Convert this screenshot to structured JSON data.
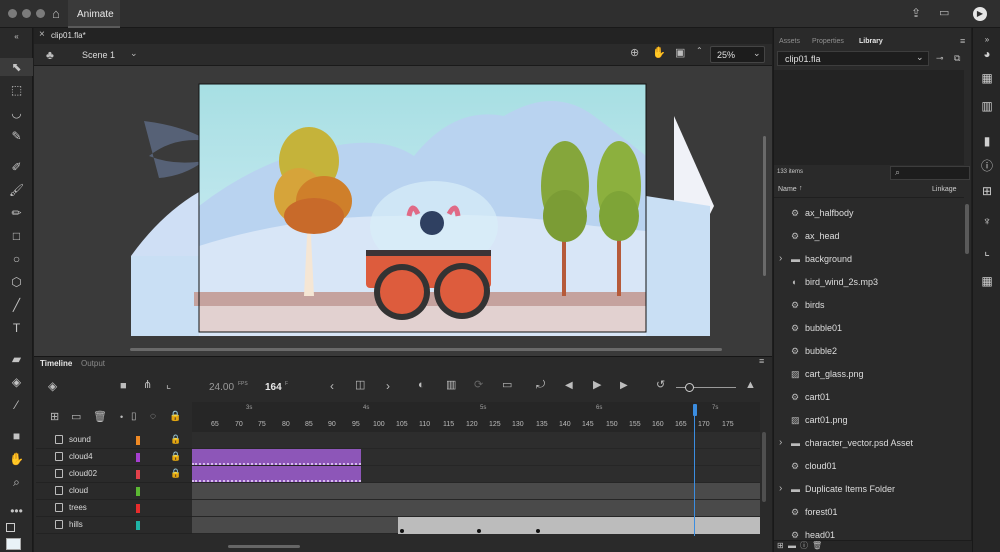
{
  "app": {
    "title": "Animate"
  },
  "document": {
    "tab": "clip01.fla*",
    "scene": "Scene 1",
    "zoom": "25%"
  },
  "timeline": {
    "tabs": [
      "Timeline",
      "Output"
    ],
    "fps_value": "24.00",
    "fps_unit": "FPS",
    "current_frame": "164",
    "frame_unit": "F",
    "seconds": [
      "3s",
      "4s",
      "5s",
      "6s",
      "7s"
    ],
    "frame_numbers": [
      "65",
      "70",
      "75",
      "80",
      "85",
      "90",
      "95",
      "100",
      "105",
      "110",
      "115",
      "120",
      "125",
      "130",
      "135",
      "140",
      "145",
      "150",
      "155",
      "160",
      "165",
      "170",
      "175"
    ],
    "layers": [
      {
        "name": "sound",
        "color": "#f08a24"
      },
      {
        "name": "cloud4",
        "color": "#a63fd0"
      },
      {
        "name": "cloud02",
        "color": "#e2414b"
      },
      {
        "name": "cloud",
        "color": "#5cb833"
      },
      {
        "name": "trees",
        "color": "#e82c2c"
      },
      {
        "name": "hills",
        "color": "#1fb3a6"
      }
    ]
  },
  "library": {
    "tabs": [
      "Assets",
      "Properties",
      "Library"
    ],
    "file": "clip01.fla",
    "count": "133 items",
    "col_name": "Name",
    "col_linkage": "Linkage",
    "items": [
      {
        "label": "ax_halfbody",
        "icon": "symbol-icon",
        "folder": false
      },
      {
        "label": "ax_head",
        "icon": "symbol-icon",
        "folder": false
      },
      {
        "label": "background",
        "icon": "folder-icon",
        "folder": true
      },
      {
        "label": "bird_wind_2s.mp3",
        "icon": "sound-icon",
        "folder": false
      },
      {
        "label": "birds",
        "icon": "symbol-icon",
        "folder": false
      },
      {
        "label": "bubble01",
        "icon": "symbol-icon",
        "folder": false
      },
      {
        "label": "bubble2",
        "icon": "symbol-icon",
        "folder": false
      },
      {
        "label": "cart_glass.png",
        "icon": "bitmap-icon",
        "folder": false
      },
      {
        "label": "cart01",
        "icon": "symbol-icon",
        "folder": false
      },
      {
        "label": "cart01.png",
        "icon": "bitmap-icon",
        "folder": false
      },
      {
        "label": "character_vector.psd Asset",
        "icon": "folder-icon",
        "folder": true
      },
      {
        "label": "cloud01",
        "icon": "symbol-icon",
        "folder": false
      },
      {
        "label": "Duplicate Items Folder",
        "icon": "folder-icon",
        "folder": true
      },
      {
        "label": "forest01",
        "icon": "symbol-icon",
        "folder": false
      },
      {
        "label": "head01",
        "icon": "symbol-icon",
        "folder": false
      }
    ]
  },
  "colors": {
    "accent": "#3b8de0",
    "purple_frames": "#8d56b8"
  }
}
